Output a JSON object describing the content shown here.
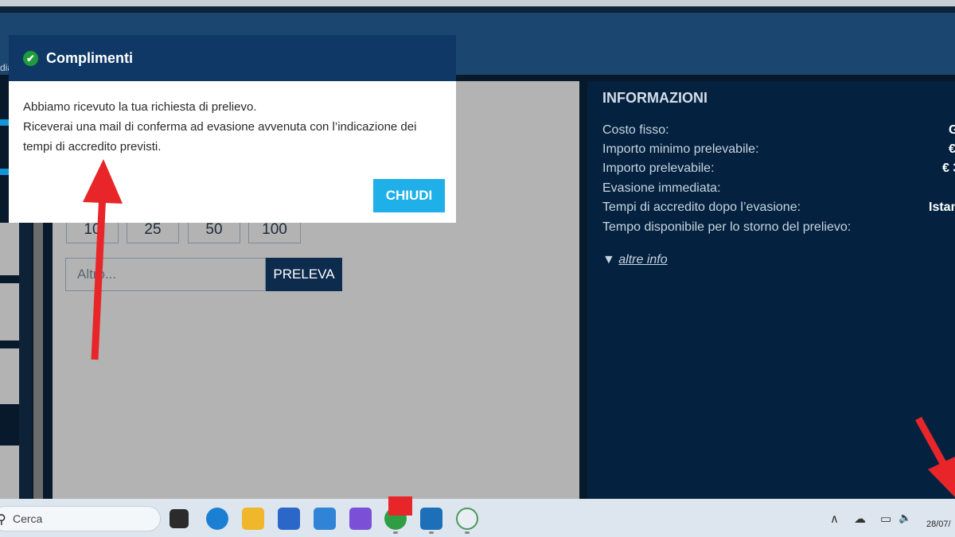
{
  "header": {
    "crumb": "dia"
  },
  "main": {
    "amounts": [
      "10",
      "25",
      "50",
      "100"
    ],
    "custom_placeholder": "Altro...",
    "submit_label": "PRELEVA"
  },
  "info": {
    "title": "INFORMAZIONI",
    "rows": [
      {
        "label": "Costo fisso:",
        "value": "G"
      },
      {
        "label": "Importo minimo prelevabile:",
        "value": "€"
      },
      {
        "label": "Importo prelevabile:",
        "value": "€ 3"
      },
      {
        "label": "Evasione immediata:",
        "value": ""
      },
      {
        "label": "Tempi di accredito dopo l’evasione:",
        "value": "Istan"
      },
      {
        "label": "Tempo disponibile per lo storno del prelievo:",
        "value": ""
      }
    ],
    "more_prefix": "▼ ",
    "more_label": "altre info"
  },
  "modal": {
    "title": "Complimenti",
    "check_icon": "✔",
    "line1": "Abbiamo ricevuto la tua richiesta di prelievo.",
    "line2": "Riceverai una mail di conferma ad evasione avvenuta con l’indicazione dei",
    "line3": "tempi di accredito previsti.",
    "close_label": "CHIUDI"
  },
  "taskbar": {
    "search_label": "Cerca",
    "search_icon": "⚲",
    "tray_chevron": "∧",
    "tray_cloud": "☁",
    "tray_monitor": "▭",
    "tray_speaker": "🔈",
    "date": "28/07/"
  },
  "colors": {
    "modal_header": "#0f3866",
    "accent_button": "#1fb0ea",
    "arrow": "#e8262a",
    "info_panel": "#04223f"
  }
}
